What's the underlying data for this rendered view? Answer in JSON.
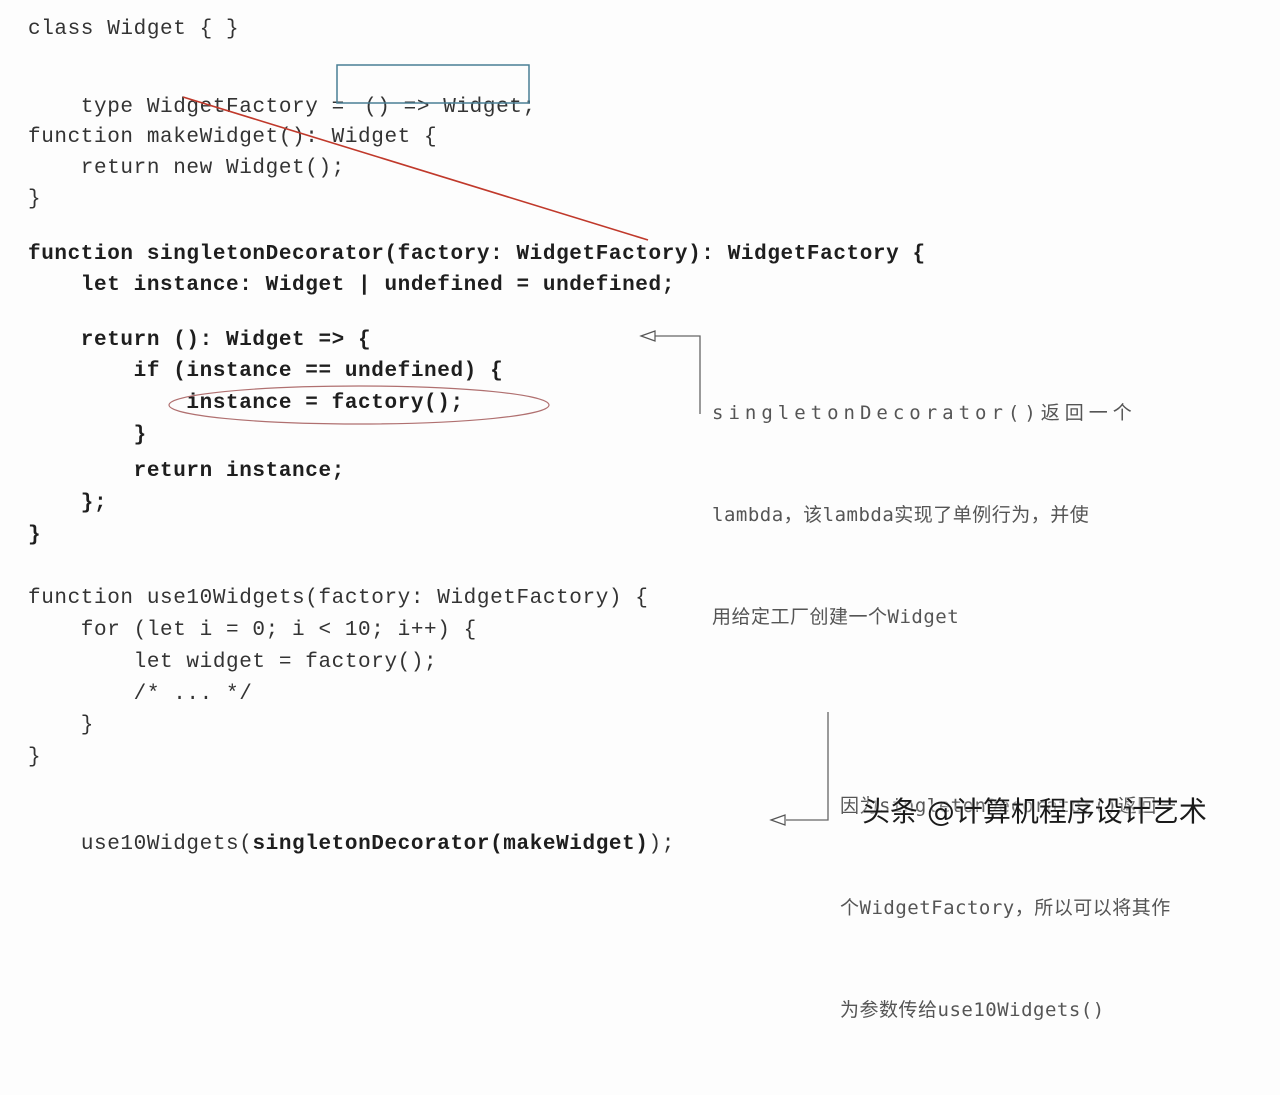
{
  "code": {
    "lines": [
      "class Widget { }",
      "type WidgetFactory = ",
      "() => Widget",
      ";",
      "function makeWidget(): Widget {",
      "    return new Widget();",
      "}",
      "function singletonDecorator(factory: WidgetFactory): WidgetFactory {",
      "    let instance: Widget | undefined = undefined;",
      "    return (): Widget => {",
      "        if (instance == undefined) {",
      "            instance = factory();",
      "        }",
      "        return instance;",
      "    };",
      "}",
      "function use10Widgets(factory: WidgetFactory) {",
      "    for (let i = 0; i < 10; i++) {",
      "        let widget = factory();",
      "        /* ... */",
      "    }",
      "}",
      "use10Widgets(",
      "singletonDecorator(makeWidget)",
      ");"
    ]
  },
  "annotations": {
    "lambda_note": [
      "singletonDecorator()返回一个",
      "lambda，该lambda实现了单例行为，并使",
      "用给定工厂创建一个Widget"
    ],
    "factory_note": [
      "因为singletonDecorator()返回一",
      "个WidgetFactory，所以可以将其作",
      "为参数传给use10Widgets()"
    ]
  },
  "watermark": "头条 @计算机程序设计艺术",
  "colors": {
    "highlight_box": "#4a7f95",
    "red_connector": "#c0392b",
    "ellipse": "#b07070",
    "callout_line": "#666666"
  }
}
